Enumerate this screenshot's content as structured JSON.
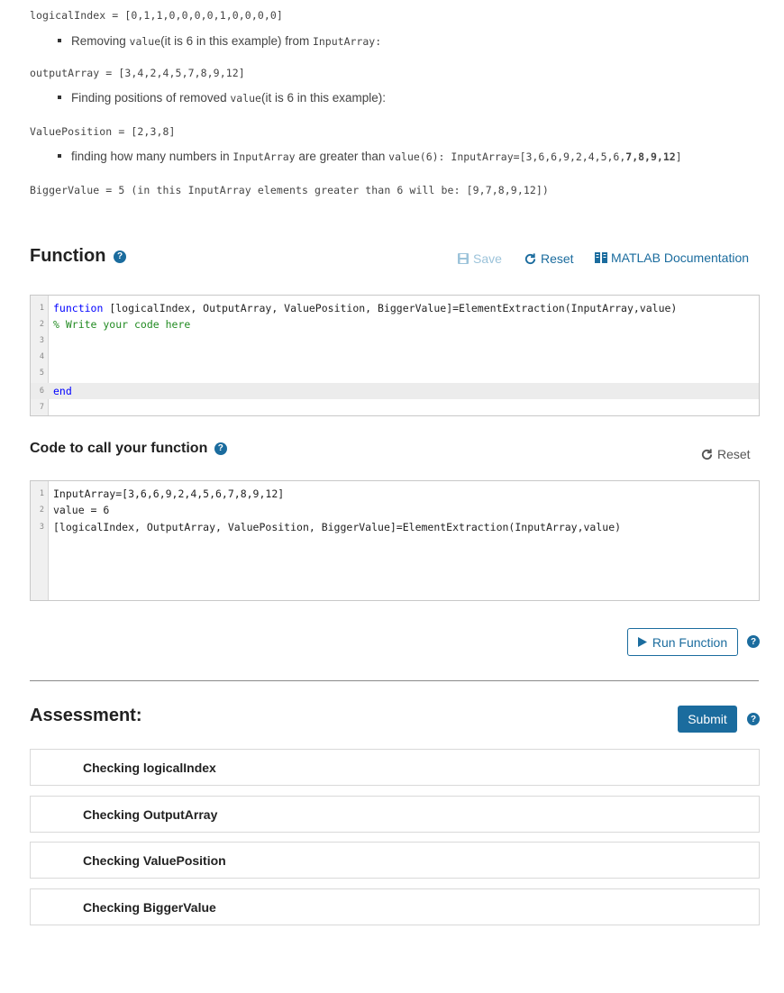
{
  "description": {
    "line1": "logicalIndex = [0,1,1,0,0,0,0,1,0,0,0,0]",
    "bullet1": {
      "pre": "Removing ",
      "code": "value",
      "mid": "(it is 6 in this example) from ",
      "code2": "InputArray:"
    },
    "line2": "outputArray = [3,4,2,4,5,7,8,9,12]",
    "bullet2": {
      "pre": "Finding positions of removed ",
      "code": "value",
      "mid": "(it is 6 in this example):"
    },
    "line3": "ValuePosition = [2,3,8]",
    "bullet3": {
      "pre": "finding how many numbers in ",
      "code": "InputArray",
      "mid": " are greater than ",
      "code2": "value(6): InputArray=[3,6,6,9,2,4,5,6,",
      "code3": "7,8,9,12",
      "code4": "]"
    },
    "line4": "BiggerValue = 5 (in this InputArray elements greater than 6 will be: [9,7,8,9,12])"
  },
  "function_section": {
    "title": "Function",
    "save_label": "Save",
    "reset_label": "Reset",
    "docs_label": "MATLAB Documentation",
    "code_lines": [
      {
        "num": "1",
        "kw": "function",
        "text": " [logicalIndex, OutputArray, ValuePosition, BiggerValue]=ElementExtraction(InputArray,value)"
      },
      {
        "num": "2",
        "comment": "% Write your code here"
      },
      {
        "num": "3"
      },
      {
        "num": "4"
      },
      {
        "num": "5"
      },
      {
        "num": "6",
        "kw": "end"
      },
      {
        "num": "7"
      }
    ]
  },
  "call_section": {
    "title": "Code to call your function",
    "reset_label": "Reset",
    "code_lines": [
      {
        "num": "1",
        "text": "InputArray=[3,6,6,9,2,4,5,6,7,8,9,12]"
      },
      {
        "num": "2",
        "text": "value = 6"
      },
      {
        "num": "3",
        "text": "[logicalIndex, OutputArray, ValuePosition, BiggerValue]=ElementExtraction(InputArray,value)"
      }
    ],
    "run_label": "Run Function"
  },
  "assessment": {
    "title": "Assessment:",
    "submit_label": "Submit",
    "tests": [
      "Checking logicalIndex",
      "Checking OutputArray",
      "Checking ValuePosition",
      "Checking BiggerValue"
    ]
  },
  "colors": {
    "accent": "#1b6c9e",
    "keyword": "#0000ff",
    "comment": "#228b22"
  }
}
